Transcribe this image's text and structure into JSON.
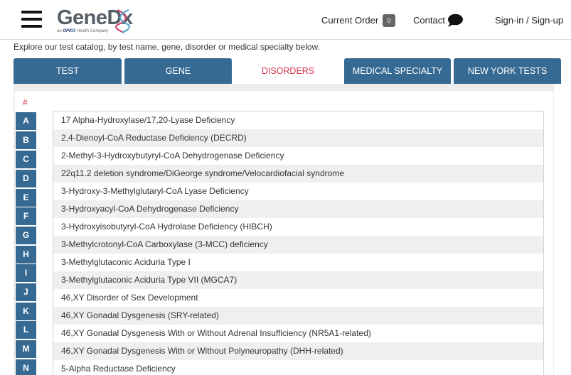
{
  "header": {
    "logo_text": "GeneDx",
    "logo_tag_prefix": "an",
    "logo_tag_brand": "OPKO",
    "logo_tag_suffix": "Health Company",
    "current_order_label": "Current Order",
    "order_count": "0",
    "contact_label": "Contact",
    "sign_label": "Sign-in / Sign-up"
  },
  "intro_text": "Explore our test catalog, by test name, gene, disorder or medical specialty below.",
  "tabs": [
    {
      "label": "TEST",
      "active": false
    },
    {
      "label": "GENE",
      "active": false
    },
    {
      "label": "DISORDERS",
      "active": true
    },
    {
      "label": "MEDICAL SPECIALTY",
      "active": false
    },
    {
      "label": "NEW YORK TESTS",
      "active": false
    }
  ],
  "hash_label": "#",
  "letters": [
    "A",
    "B",
    "C",
    "D",
    "E",
    "F",
    "G",
    "H",
    "I",
    "J",
    "K",
    "L",
    "M",
    "N"
  ],
  "disorders": [
    "17 Alpha-Hydroxylase/17,20-Lyase Deficiency",
    "2,4-Dienoyl-CoA Reductase Deficiency (DECRD)",
    "2-Methyl-3-Hydroxybutyryl-CoA Dehydrogenase Deficiency",
    "22q11.2 deletion syndrome/DiGeorge syndrome/Velocardiofacial syndrome",
    "3-Hydroxy-3-Methylglutaryl-CoA Lyase Deficiency",
    "3-Hydroxyacyl-CoA Dehydrogenase Deficiency",
    "3-Hydroxyisobutyryl-CoA Hydrolase Deficiency (HIBCH)",
    "3-Methylcrotonyl-CoA Carboxylase (3-MCC) deficiency",
    "3-Methylglutaconic Aciduria Type I",
    "3-Methylglutaconic Aciduria Type VII (MGCA7)",
    "46,XY Disorder of Sex Development",
    "46,XY Gonadal Dysgenesis (SRY-related)",
    "46,XY Gonadal Dysgenesis With or Without Adrenal Insufficiency (NR5A1-related)",
    "46,XY Gonadal Dysgenesis With or Without Polyneuropathy (DHH-related)",
    "5-Alpha Reductase Deficiency"
  ],
  "colors": {
    "tab_blue": "#376a93",
    "active_red": "#d9334f"
  },
  "icons": {
    "menu": "hamburger-menu-icon",
    "contact": "chat-bubble-icon"
  }
}
